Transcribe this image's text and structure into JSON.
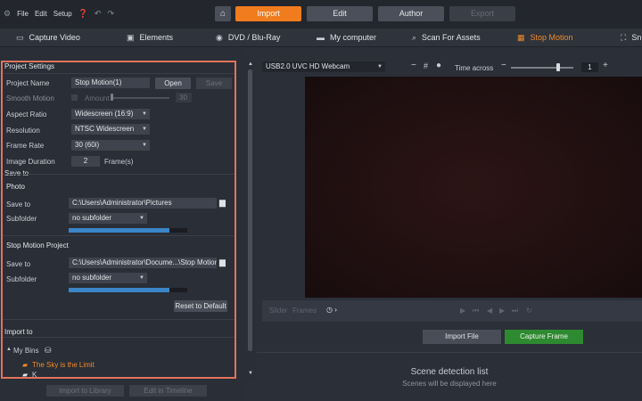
{
  "menu": {
    "file": "File",
    "edit": "Edit",
    "setup": "Setup",
    "help_icon": "help-icon",
    "undo_icon": "undo-icon",
    "redo_icon": "redo-icon"
  },
  "modes": {
    "import": "Import",
    "edit": "Edit",
    "author": "Author",
    "export": "Export"
  },
  "tabs": [
    {
      "label": "Capture Video",
      "icon": "video-icon"
    },
    {
      "label": "Elements",
      "icon": "elements-icon"
    },
    {
      "label": "DVD / Blu-Ray",
      "icon": "disc-icon"
    },
    {
      "label": "My computer",
      "icon": "folder-icon"
    },
    {
      "label": "Scan For Assets",
      "icon": "search-icon"
    },
    {
      "label": "Stop Motion",
      "icon": "stopmotion-icon"
    },
    {
      "label": "Sn",
      "icon": "snapshot-icon"
    }
  ],
  "settings": {
    "section_title": "Project Settings",
    "project_name_label": "Project Name",
    "project_name_value": "Stop Motion(1)",
    "open_label": "Open",
    "save_label": "Save",
    "smooth_motion_label": "Smooth Motion",
    "amount_label": "Amount",
    "amount_value": "30",
    "aspect_ratio_label": "Aspect Ratio",
    "aspect_ratio_value": "Widescreen (16:9)",
    "resolution_label": "Resolution",
    "resolution_value": "NTSC Widescreen",
    "frame_rate_label": "Frame Rate",
    "frame_rate_value": "30 (60i)",
    "image_duration_label": "Image Duration",
    "image_duration_value": "2",
    "frames_unit": "Frame(s)",
    "save_to_header": "Save to",
    "photo_header": "Photo",
    "photo_save_to_label": "Save to",
    "photo_path": "C:\\Users\\Administrator\\Pictures",
    "photo_subfolder_label": "Subfolder",
    "photo_subfolder_value": "no subfolder",
    "photo_progress": 0.85,
    "smp_header": "Stop Motion Project",
    "smp_save_to_label": "Save to",
    "smp_path": "C:\\Users\\Administrator\\Docume...\\Stop Motion",
    "smp_subfolder_label": "Subfolder",
    "smp_subfolder_value": "no subfolder",
    "smp_progress": 0.85,
    "reset_label": "Reset to Default",
    "import_to_header": "Import to",
    "my_bins_label": "My Bins",
    "bin_item_1": "The Sky is the Limit",
    "bin_item_2": "K"
  },
  "bottom_buttons": {
    "import_library": "Import to Library",
    "edit_timeline": "Edit in Timeline"
  },
  "capture": {
    "device": "USB2.0 UVC HD Webcam",
    "time_across_label": "Time across",
    "time_across_value": "1",
    "zoom_level": 0.75,
    "transport_slider_label": "Slider",
    "transport_frames_label": "Frames",
    "import_file": "Import File",
    "capture_frame": "Capture Frame",
    "scene_title": "Scene detection list",
    "scene_sub": "Scenes will be displayed here"
  },
  "colors": {
    "accent": "#f07c1e",
    "capture_green": "#2e8a30",
    "outline": "#e2735c"
  }
}
